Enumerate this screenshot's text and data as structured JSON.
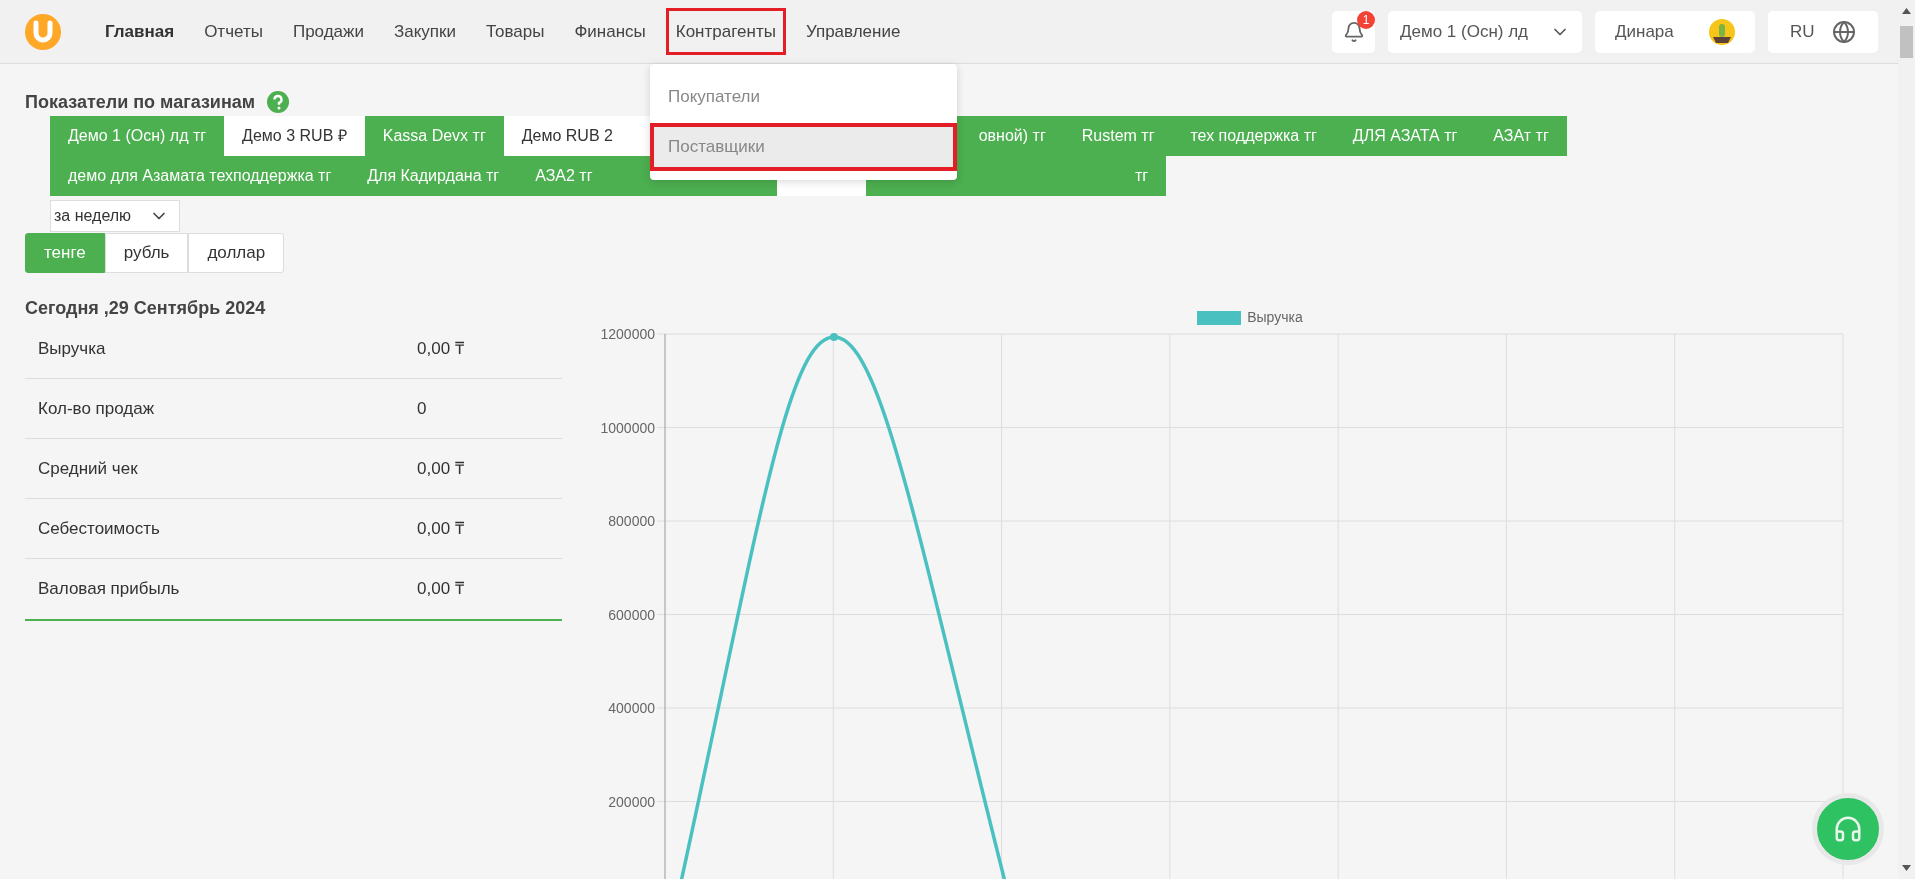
{
  "nav": {
    "items": [
      {
        "label": "Главная",
        "selected": true,
        "outlined": false
      },
      {
        "label": "Отчеты",
        "selected": false,
        "outlined": false
      },
      {
        "label": "Продажи",
        "selected": false,
        "outlined": false
      },
      {
        "label": "Закупки",
        "selected": false,
        "outlined": false
      },
      {
        "label": "Товары",
        "selected": false,
        "outlined": false
      },
      {
        "label": "Финансы",
        "selected": false,
        "outlined": false
      },
      {
        "label": "Контрагенты",
        "selected": false,
        "outlined": true
      },
      {
        "label": "Управление",
        "selected": false,
        "outlined": false
      }
    ],
    "notifications": {
      "count": "1"
    },
    "store_select": {
      "value": "Демо 1 (Осн) лд"
    },
    "user": {
      "name": "Динара"
    },
    "language": {
      "value": "RU"
    }
  },
  "dropdown": {
    "items": [
      {
        "label": "Покупатели",
        "hovered": false,
        "outlined": false
      },
      {
        "label": "Поставщики",
        "hovered": true,
        "outlined": true
      }
    ]
  },
  "page_title": "Показатели по магазинам",
  "store_tabs": [
    [
      {
        "label": "Демо 1 (Осн) лд тг",
        "selected": true,
        "kind": "plain"
      },
      {
        "label": "Демо 3 RUB ₽",
        "selected": false,
        "kind": "plain"
      },
      {
        "label": "Kassa Devx тг",
        "selected": true,
        "kind": "plain"
      },
      {
        "label": "Демо RUB 2",
        "selected": false,
        "kind": "cut_end"
      },
      {
        "label": "овной) тг",
        "selected": true,
        "kind": "cut_start"
      },
      {
        "label": "Rustem тг",
        "selected": true,
        "kind": "plain"
      },
      {
        "label": "тех поддержка тг",
        "selected": true,
        "kind": "plain"
      },
      {
        "label": "ДЛЯ АЗАТА тг",
        "selected": true,
        "kind": "plain"
      },
      {
        "label": "АЗАт тг",
        "selected": true,
        "kind": "plain"
      }
    ],
    [
      {
        "label": "демо для Азамата техподдержка тг",
        "selected": true,
        "kind": "plain"
      },
      {
        "label": "Для Кадирдана тг",
        "selected": true,
        "kind": "plain"
      },
      {
        "label": "АЗА2 тг",
        "selected": true,
        "kind": "cut_end"
      },
      {
        "selected": false,
        "kind": "hidden"
      },
      {
        "label": "тг",
        "selected": true,
        "kind": "cut_start"
      }
    ]
  ],
  "period_select": {
    "value": "за неделю"
  },
  "currencies": [
    {
      "label": "тенге",
      "selected": true
    },
    {
      "label": "рубль",
      "selected": false
    },
    {
      "label": "доллар",
      "selected": false
    }
  ],
  "today": {
    "title": "Сегодня ,29 Сентябрь 2024",
    "rows": [
      {
        "label": "Выручка",
        "value": "0,00 ₸"
      },
      {
        "label": "Кол-во продаж",
        "value": "0"
      },
      {
        "label": "Средний чек",
        "value": "0,00 ₸"
      },
      {
        "label": "Себестоимость",
        "value": "0,00 ₸"
      },
      {
        "label": "Валовая прибыль",
        "value": "0,00 ₸"
      }
    ]
  },
  "chart": {
    "legend": "Выручка",
    "tick_labels": [
      "1200000",
      "1000000",
      "800000",
      "600000",
      "400000",
      "200000"
    ]
  }
}
